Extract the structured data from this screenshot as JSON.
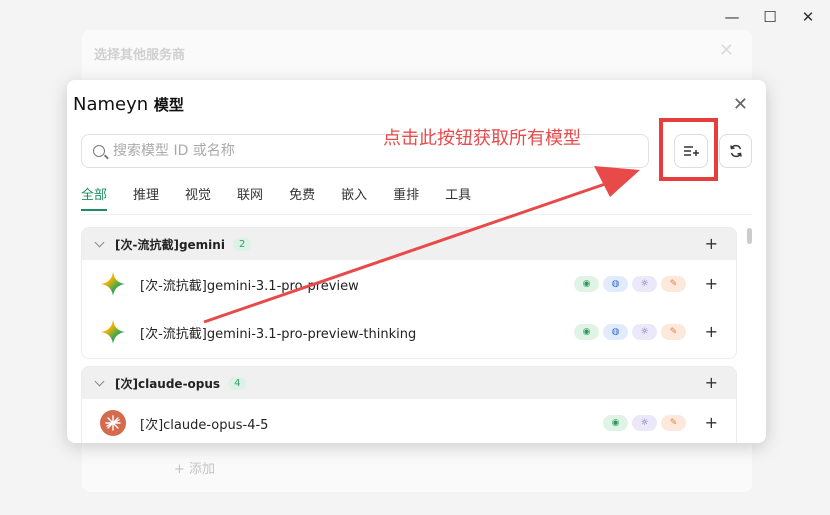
{
  "window": {
    "minimize": "—",
    "maximize": "☐",
    "close": "✕"
  },
  "background_dialog": {
    "title": "选择其他服务商",
    "add_label": "+ 添加",
    "close": "✕"
  },
  "dialog": {
    "title_name": "Nameyn",
    "title_suffix": "模型",
    "close": "✕",
    "search_placeholder": "搜索模型 ID 或名称",
    "annotation": "点击此按钮获取所有模型",
    "tabs": [
      "全部",
      "推理",
      "视觉",
      "联网",
      "免费",
      "嵌入",
      "重排",
      "工具"
    ],
    "groups": [
      {
        "name": "[次-流抗截]gemini",
        "count": "2",
        "plus": "+",
        "models": [
          {
            "name": "[次-流抗截]gemini-3.1-pro-preview",
            "icon": "gemini-icon",
            "caps": [
              "vision",
              "web",
              "reason",
              "tool"
            ]
          },
          {
            "name": "[次-流抗截]gemini-3.1-pro-preview-thinking",
            "icon": "gemini-icon",
            "caps": [
              "vision",
              "web",
              "reason",
              "tool"
            ]
          }
        ]
      },
      {
        "name": "[次]claude-opus",
        "count": "4",
        "plus": "+",
        "models": [
          {
            "name": "[次]claude-opus-4-5",
            "icon": "claude-icon",
            "caps": [
              "vision",
              "reason",
              "tool"
            ]
          }
        ]
      }
    ]
  },
  "colors": {
    "accent": "#1a8f5d",
    "annotation": "#e84a4a",
    "highlight_box": "#e83d3d"
  }
}
